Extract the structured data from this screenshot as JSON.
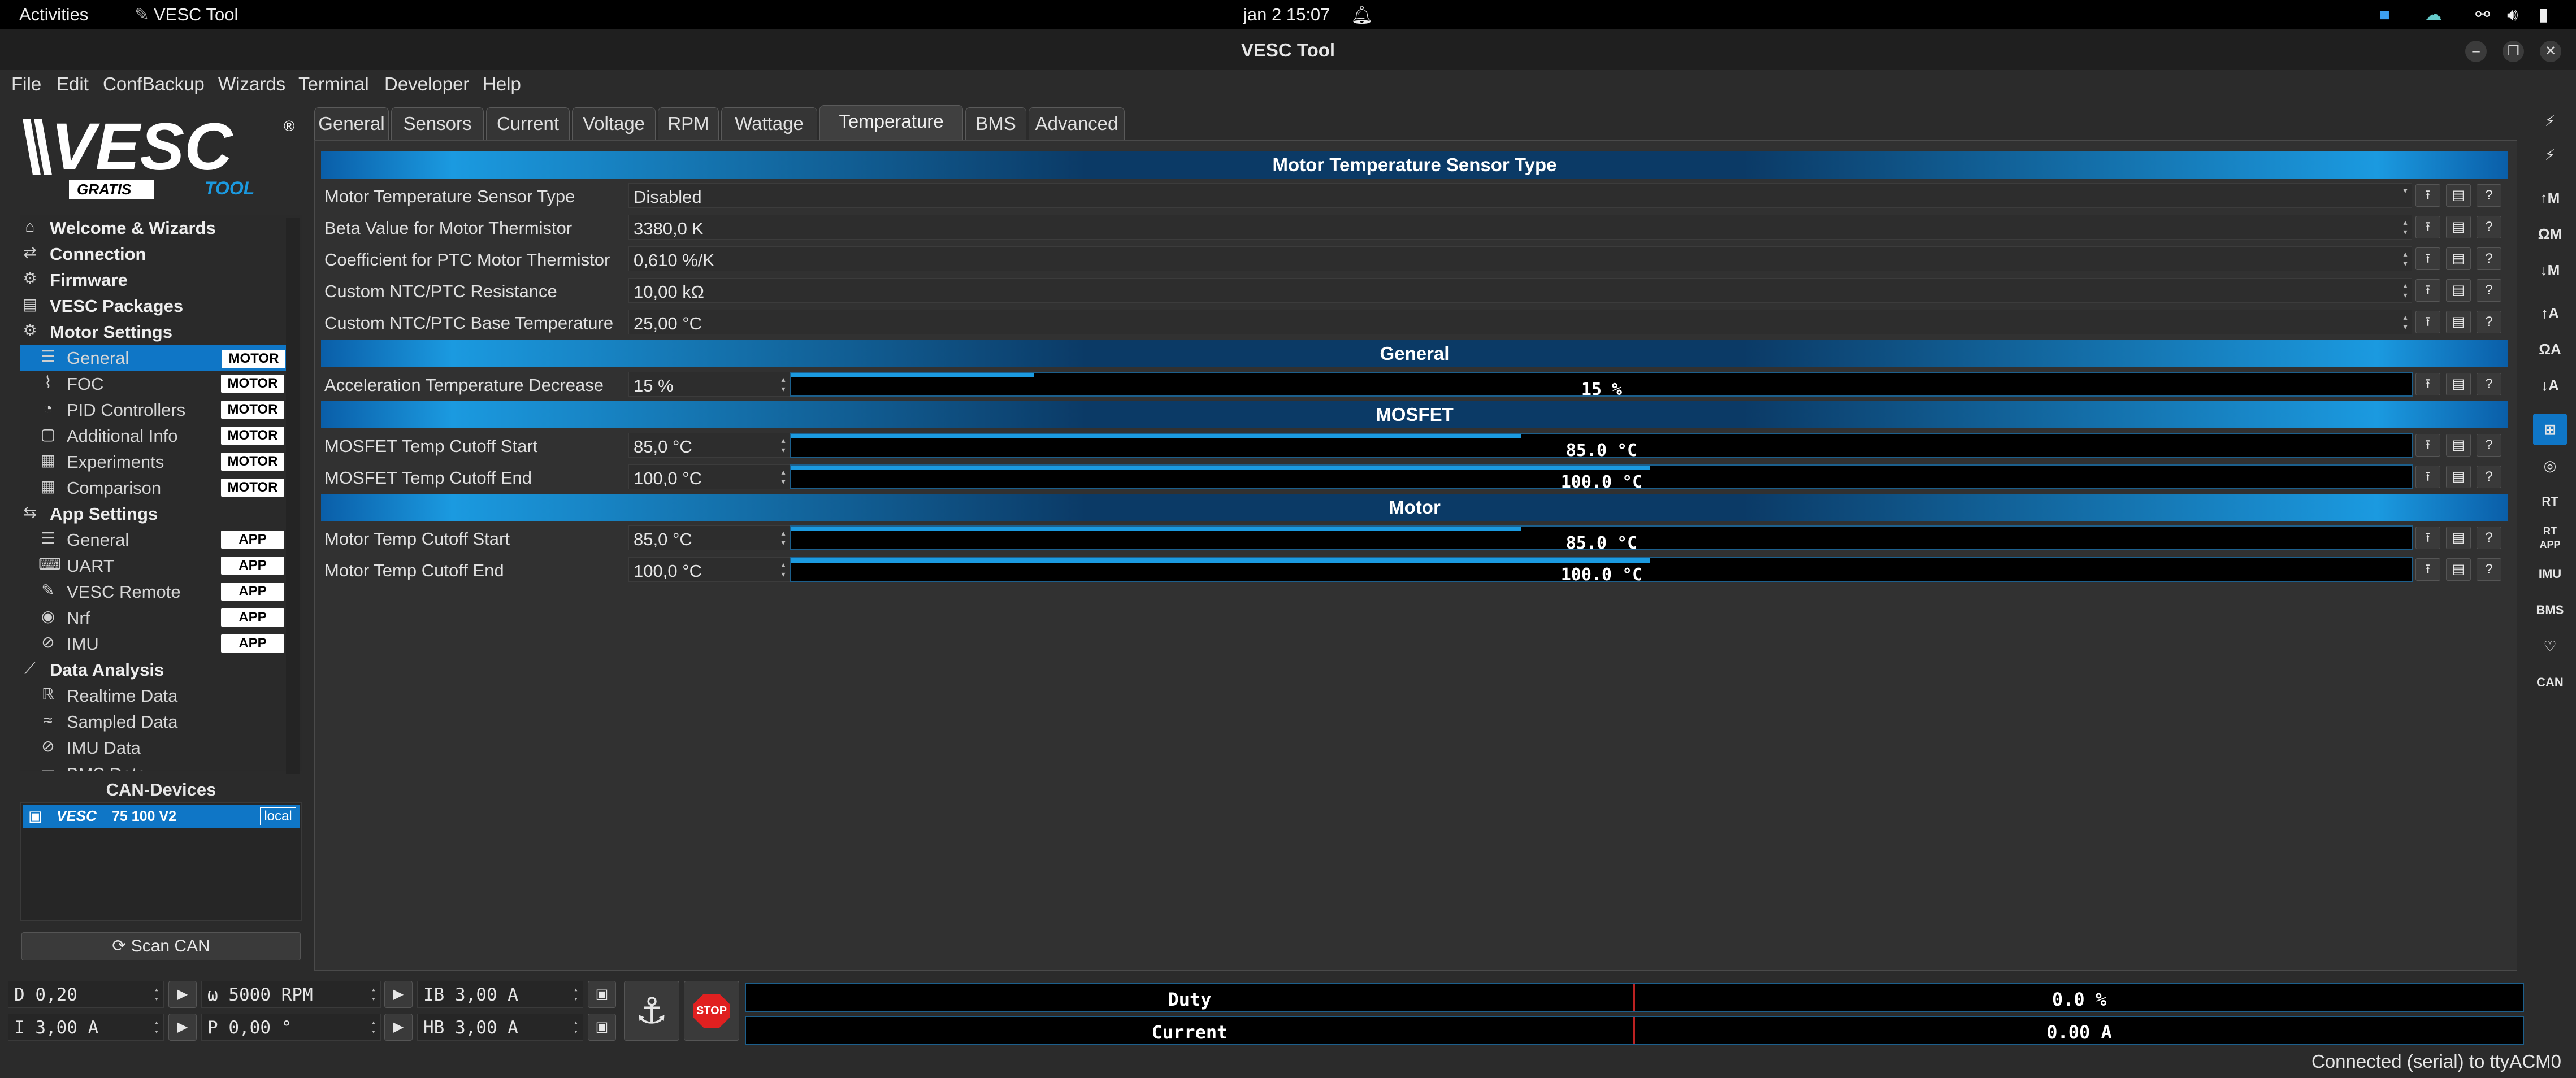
{
  "sysbar": {
    "activities": "Activities",
    "app": "VESC Tool",
    "clock": "jan 2  15:07"
  },
  "window": {
    "title": "VESC Tool"
  },
  "menu": [
    "File",
    "Edit",
    "ConfBackup",
    "Wizards",
    "Terminal",
    "Developer",
    "Help"
  ],
  "logo": {
    "brand": "VESC",
    "gratis": "GRATIS",
    "tool": "TOOL"
  },
  "tree": {
    "welcome": "Welcome & Wizards",
    "connection": "Connection",
    "firmware": "Firmware",
    "packages": "VESC Packages",
    "motor_settings": "Motor Settings",
    "motor_items": [
      {
        "label": "General",
        "badge": "MOTOR",
        "icon": "sliders-icon"
      },
      {
        "label": "FOC",
        "badge": "MOTOR",
        "icon": "foc-icon"
      },
      {
        "label": "PID Controllers",
        "badge": "MOTOR",
        "icon": "gauge-icon"
      },
      {
        "label": "Additional Info",
        "badge": "MOTOR",
        "icon": "info-icon"
      },
      {
        "label": "Experiments",
        "badge": "MOTOR",
        "icon": "calculator-icon"
      },
      {
        "label": "Comparison",
        "badge": "MOTOR",
        "icon": "calculator-icon"
      }
    ],
    "app_settings": "App Settings",
    "app_items": [
      {
        "label": "General",
        "badge": "APP",
        "icon": "sliders-icon"
      },
      {
        "label": "UART",
        "badge": "APP",
        "icon": "keyboard-icon"
      },
      {
        "label": "VESC Remote",
        "badge": "APP",
        "icon": "remote-icon"
      },
      {
        "label": "Nrf",
        "badge": "APP",
        "icon": "wireless-icon"
      },
      {
        "label": "IMU",
        "badge": "APP",
        "icon": "imu-icon"
      }
    ],
    "data_analysis": "Data Analysis",
    "data_items": [
      "Realtime Data",
      "Sampled Data",
      "IMU Data",
      "BMS Data"
    ]
  },
  "can": {
    "title": "CAN-Devices",
    "device": "75 100 V2",
    "device_brand": "VESC",
    "tag": "local",
    "scan": "Scan CAN"
  },
  "tabs": [
    "General",
    "Sensors",
    "Current",
    "Voltage",
    "RPM",
    "Wattage",
    "Temperature",
    "BMS",
    "Advanced"
  ],
  "active_tab": "Temperature",
  "sections": {
    "sensor_type": "Motor Temperature Sensor Type",
    "general": "General",
    "mosfet": "MOSFET",
    "motor": "Motor"
  },
  "params": {
    "sensor_type": {
      "label": "Motor Temperature Sensor Type",
      "value": "Disabled"
    },
    "beta": {
      "label": "Beta Value for Motor Thermistor",
      "value": "3380,0 K"
    },
    "ptc_coeff": {
      "label": "Coefficient for PTC Motor Thermistor",
      "value": "0,610 %/K"
    },
    "ntc_res": {
      "label": "Custom NTC/PTC Resistance",
      "value": "10,00 kΩ"
    },
    "ntc_base": {
      "label": "Custom NTC/PTC Base Temperature",
      "value": "25,00 °C"
    },
    "accel_decrease": {
      "label": "Acceleration Temperature Decrease",
      "value": "15 %",
      "bar": "15 %",
      "fraction": 0.15
    },
    "mos_start": {
      "label": "MOSFET Temp Cutoff Start",
      "value": "85,0 °C",
      "bar": "85.0 °C",
      "fraction": 0.45
    },
    "mos_end": {
      "label": "MOSFET Temp Cutoff End",
      "value": "100,0 °C",
      "bar": "100.0 °C",
      "fraction": 0.53
    },
    "mot_start": {
      "label": "Motor Temp Cutoff Start",
      "value": "85,0 °C",
      "bar": "85.0 °C",
      "fraction": 0.45
    },
    "mot_end": {
      "label": "Motor Temp Cutoff End",
      "value": "100,0 °C",
      "bar": "100.0 °C",
      "fraction": 0.53
    }
  },
  "bottom": {
    "duty": "D 0,20",
    "rpm": "ω 5000 RPM",
    "ib": "IB 3,00 A",
    "current": "I 3,00 A",
    "pos": "P 0,00 °",
    "hb": "HB 3,00 A",
    "stop": "STOP",
    "meter_duty_label": "Duty",
    "meter_duty_value": "0.0 %",
    "meter_current_label": "Current",
    "meter_current_value": "0.00 A"
  },
  "right_toolbar": [
    "↑M",
    "ΩM",
    "↓M",
    "↑A",
    "ΩA",
    "↓A",
    "RT",
    "RT APP",
    "IMU",
    "BMS",
    "CAN"
  ],
  "status": "Connected (serial) to ttyACM0",
  "colors": {
    "accent": "#0f76c6",
    "bar_fill": "#1b9ae0",
    "background": "#2b2b2b"
  }
}
